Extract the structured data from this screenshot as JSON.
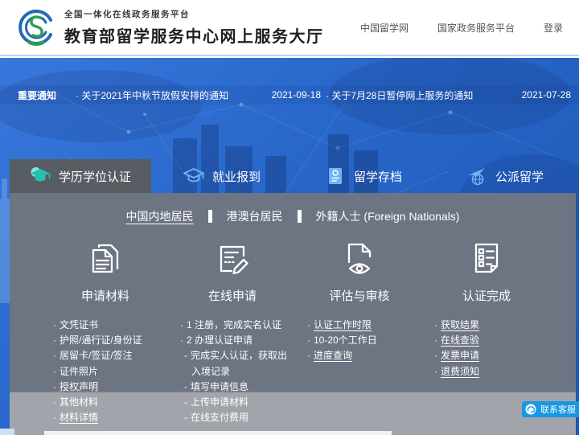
{
  "header": {
    "platform_label": "全国一体化在线政务服务平台",
    "site_title": "教育部留学服务中心网上服务大厅",
    "nav": [
      {
        "label": "中国留学网"
      },
      {
        "label": "国家政务服务平台"
      },
      {
        "label": "登录"
      }
    ]
  },
  "notice_bar": {
    "label": "重要通知",
    "notices": [
      {
        "title": "· 关于2021年中秋节放假安排的通知",
        "date": "2021-09-18"
      },
      {
        "title": "· 关于7月28日暂停网上服务的通知",
        "date": "2021-07-28"
      }
    ]
  },
  "tabs": [
    {
      "label": "学历学位认证",
      "icon": "graduation-cap-icon",
      "active": true
    },
    {
      "label": "就业报到",
      "icon": "graduation-cap-icon",
      "active": false
    },
    {
      "label": "留学存档",
      "icon": "archive-document-icon",
      "active": false
    },
    {
      "label": "公派留学",
      "icon": "airplane-globe-icon",
      "active": false
    }
  ],
  "subtabs": [
    {
      "label": "中国内地居民",
      "active": true
    },
    {
      "label": "港澳台居民",
      "active": false
    },
    {
      "label": "外籍人士 (Foreign Nationals)",
      "active": false
    }
  ],
  "columns": [
    {
      "title": "申请材料",
      "icon": "documents-icon",
      "items": [
        {
          "bullet": "·",
          "text": "文凭证书",
          "link": false
        },
        {
          "bullet": "·",
          "text": "护照/通行证/身份证",
          "link": false
        },
        {
          "bullet": "·",
          "text": "居留卡/签证/签注",
          "link": false
        },
        {
          "bullet": "·",
          "text": "证件照片",
          "link": false
        },
        {
          "bullet": "·",
          "text": "授权声明",
          "link": false
        },
        {
          "bullet": "·",
          "text": "其他材料",
          "link": false
        },
        {
          "bullet": "·",
          "text": "材料详情",
          "link": true
        }
      ]
    },
    {
      "title": "在线申请",
      "icon": "form-pencil-icon",
      "items": [
        {
          "bullet": "·",
          "text": "1 注册，完成实名认证",
          "link": false
        },
        {
          "bullet": "·",
          "text": "2 办理认证申请",
          "link": false
        },
        {
          "bullet": "-",
          "text": "完成实人认证，获取出入境记录",
          "link": false
        },
        {
          "bullet": "-",
          "text": "填写申请信息",
          "link": false
        },
        {
          "bullet": "-",
          "text": "上传申请材料",
          "link": false
        },
        {
          "bullet": "-",
          "text": "在线支付费用",
          "link": false
        }
      ]
    },
    {
      "title": "评估与审核",
      "icon": "document-eye-icon",
      "items": [
        {
          "bullet": "·",
          "text": "认证工作时限",
          "link": true
        },
        {
          "bullet": "·",
          "text": "10-20个工作日",
          "link": false
        },
        {
          "bullet": "·",
          "text": "进度查询",
          "link": true
        }
      ]
    },
    {
      "title": "认证完成",
      "icon": "checklist-icon",
      "items": [
        {
          "bullet": "·",
          "text": "获取结果",
          "link": true
        },
        {
          "bullet": "·",
          "text": "在线查验",
          "link": true
        },
        {
          "bullet": "·",
          "text": "发票申请",
          "link": true
        },
        {
          "bullet": "·",
          "text": "退费须知",
          "link": true
        }
      ]
    }
  ],
  "contact": {
    "label": "联系客服"
  },
  "colors": {
    "primary_blue": "#2a6ad2",
    "panel_gray": "#6d7482",
    "panel_light_band": "#a1a5ab",
    "active_tab_gray": "#585c63",
    "active_tab_icon_teal": "#26c0ae",
    "tab_icon_blue": "#6fb5f3",
    "contact_button_blue": "#1798e3",
    "logo_blue": "#1e6cb5",
    "logo_green": "#2e9e4f"
  }
}
